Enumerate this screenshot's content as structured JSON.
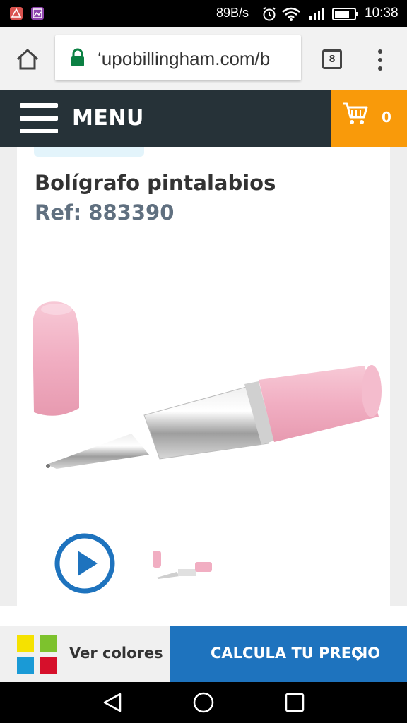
{
  "status_bar": {
    "network_speed": "89B/s",
    "time": "10:38"
  },
  "browser": {
    "url": "‘upobillingham.com/b",
    "tab_count": "8"
  },
  "site_nav": {
    "menu_label": "MENU",
    "cart_count": "0"
  },
  "product": {
    "title": "Bolígrafo pintalabios",
    "ref": "Ref: 883390"
  },
  "actions": {
    "ver_colores_label": "Ver colores",
    "calcula_label": "CALCULA TU PRECIO",
    "color_swatches": [
      "#f5e200",
      "#7dc22d",
      "#1a9ad6",
      "#d6102b"
    ]
  },
  "colors": {
    "nav_bg": "#263238",
    "cart_bg": "#f99a0a",
    "cta_bg": "#1e73be",
    "play_blue": "#1e73be",
    "lipstick_pink": "#f2b3c5"
  }
}
